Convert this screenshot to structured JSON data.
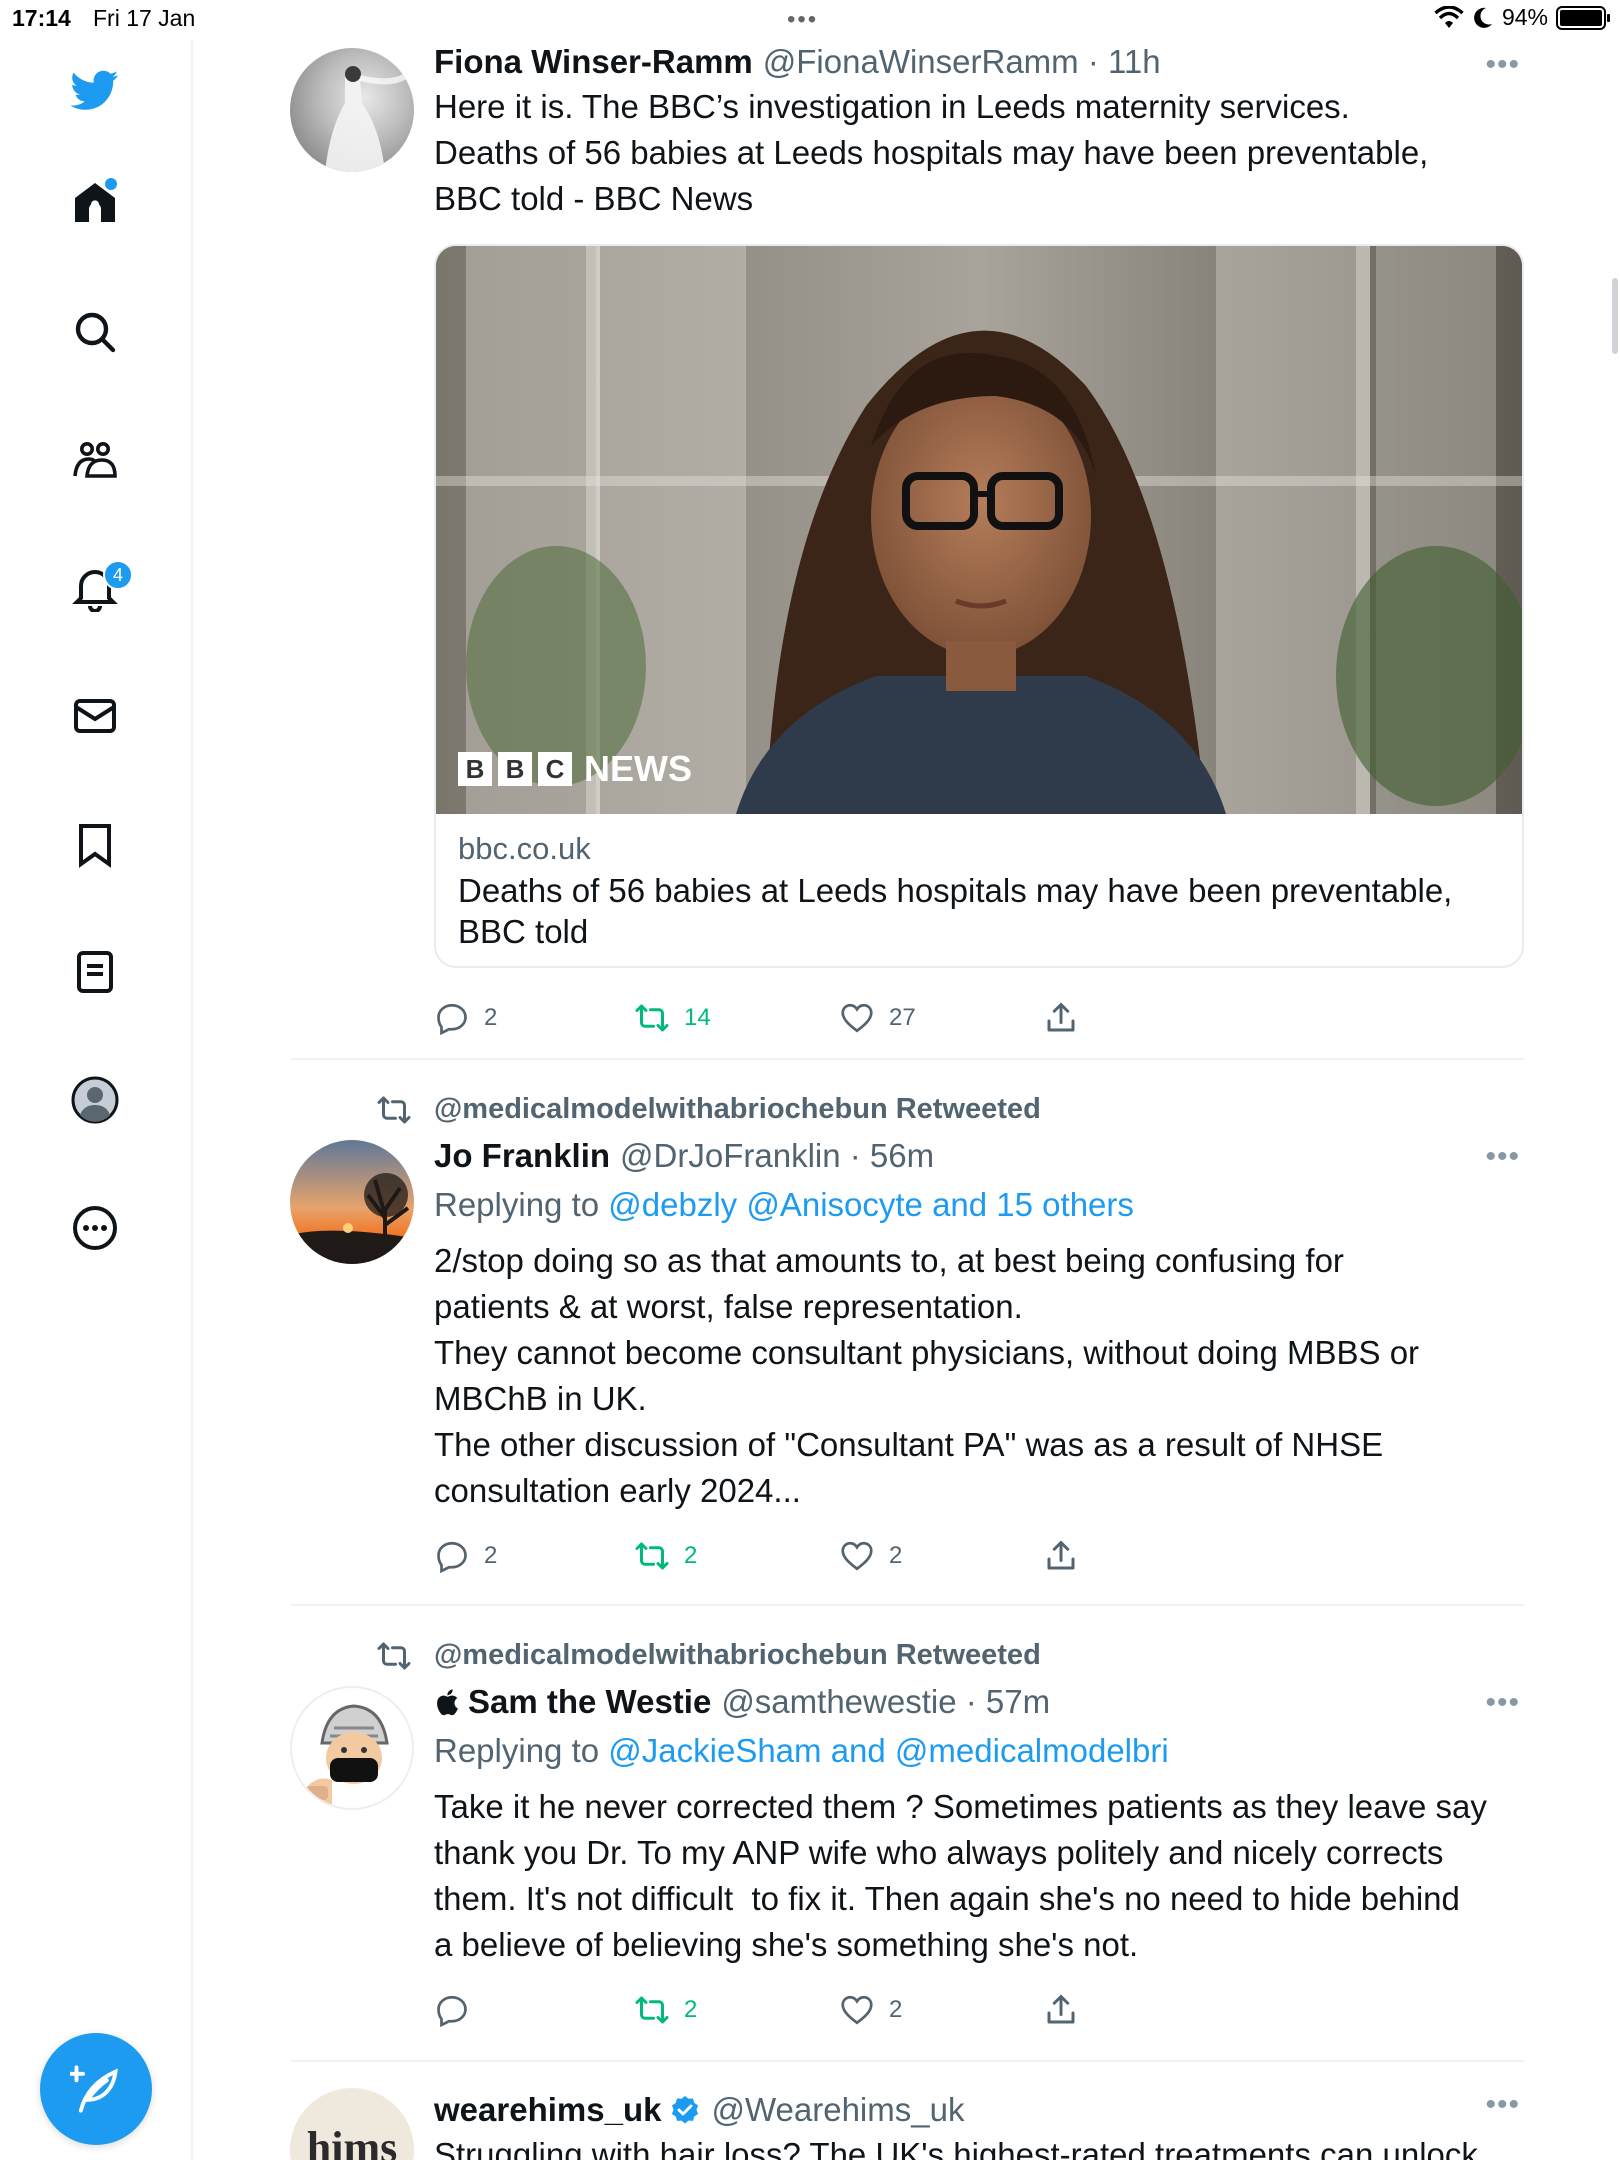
{
  "status": {
    "time": "17:14",
    "date": "Fri 17 Jan",
    "battery": "94%"
  },
  "sidebar": {
    "notification_badge": "4",
    "items": [
      "home-icon",
      "search-icon",
      "communities-icon",
      "notifications-icon",
      "messages-icon",
      "bookmarks-icon",
      "lists-icon",
      "profile-icon",
      "more-icon"
    ]
  },
  "tweets": [
    {
      "name": "Fiona Winser-Ramm",
      "handle": "@FionaWinserRamm · 11h",
      "lines": [
        "Here it is. The BBC’s investigation in Leeds maternity services.",
        "Deaths of 56 babies at Leeds hospitals may have been preventable,",
        "BBC told - BBC News"
      ],
      "card": {
        "logo": "NEWS",
        "logo_letters": [
          "B",
          "B",
          "C"
        ],
        "domain": "bbc.co.uk",
        "title_lines": [
          "Deaths of 56 babies at Leeds hospitals may have been preventable,",
          "BBC told"
        ]
      },
      "replies": "2",
      "retweets": "14",
      "likes": "27"
    },
    {
      "retweeted_by": "@medicalmodelwithabriochebun Retweeted",
      "name": "Jo Franklin",
      "handle": "@DrJoFranklin · 56m",
      "replying_prefix": "Replying to",
      "replying_to": "@debzly @Anisocyte and 15 others",
      "lines": [
        "2/stop doing so as that amounts to, at best being confusing for",
        "patients & at worst, false representation.",
        "They cannot become consultant physicians, without doing MBBS or",
        "MBChB in UK.",
        "The other discussion of \"Consultant PA\" was as a result of NHSE",
        "consultation early 2024..."
      ],
      "replies": "2",
      "retweets": "2",
      "likes": "2"
    },
    {
      "retweeted_by": "@medicalmodelwithabriochebun Retweeted",
      "name": "Sam the Westie",
      "handle": "@samthewestie · 57m",
      "replying_prefix": "Replying to",
      "replying_to": "@JackieSham and @medicalmodelbri",
      "lines": [
        "Take it he never corrected them ? Sometimes patients as they leave say",
        "thank you Dr. To my ANP wife who always politely and nicely corrects",
        "them. It's not difficult  to fix it. Then again she's no need to hide behind",
        "a believe of believing she's something she's not."
      ],
      "replies": "",
      "retweets": "2",
      "likes": "2"
    },
    {
      "name": "wearehims_uk",
      "handle": "@Wearehims_uk",
      "avatar_text": "hims",
      "lines": [
        "Struggling with hair loss? The UK's highest-rated treatments can unlock"
      ]
    }
  ],
  "colors": {
    "accent": "#1d9bf0",
    "retweet": "#00ba7c",
    "secondary": "#536471"
  }
}
